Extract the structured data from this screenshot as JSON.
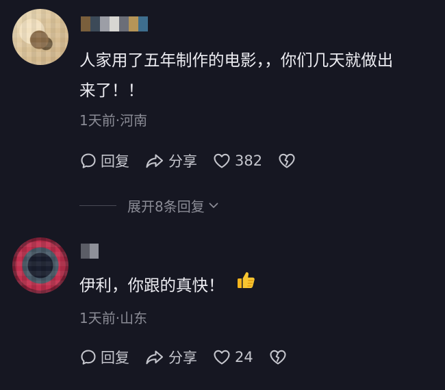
{
  "comments": [
    {
      "text": "人家用了五年制作的电影，，你们几天就做出来了！！",
      "text_line1": "人家用了五年制作的电影，，你们几天就做出",
      "text_line2": "来了！！",
      "meta": "1天前·河南",
      "reply_label": "回复",
      "share_label": "分享",
      "like_count": "382"
    },
    {
      "text": "伊利，你跟的真快！",
      "emoji": "thumbs-up",
      "meta": "1天前·山东",
      "reply_label": "回复",
      "share_label": "分享",
      "like_count": "24"
    }
  ],
  "expand_replies_label": "展开8条回复",
  "icons": {
    "reply": "speech-bubble-icon",
    "share": "share-arrow-icon",
    "like": "heart-icon",
    "dislike": "broken-heart-icon",
    "expand": "chevron-down-icon"
  },
  "colors": {
    "background": "#161722",
    "text": "#ececf1",
    "meta": "#8b8c96",
    "action": "#c5c6cd"
  }
}
